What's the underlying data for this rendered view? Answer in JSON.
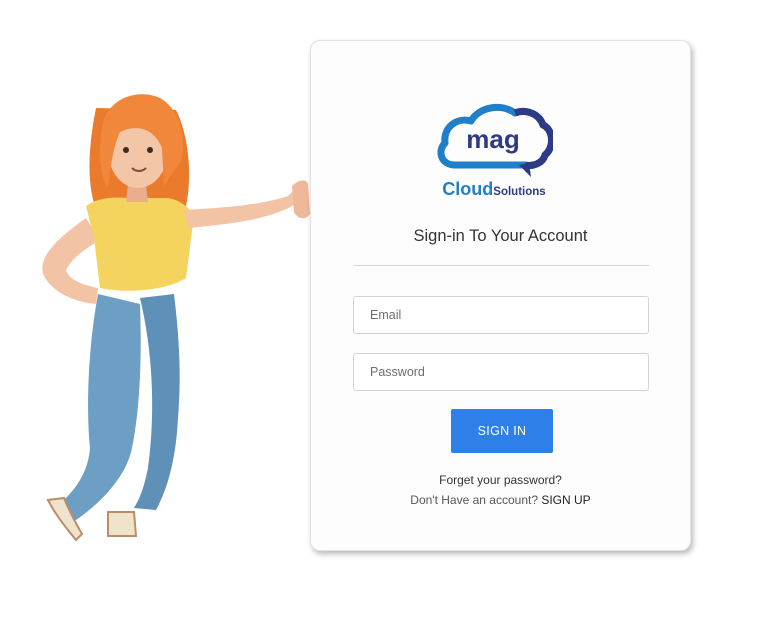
{
  "logo": {
    "mark_text": "mag",
    "word_cloud": "Cloud",
    "word_solutions": "Solutions"
  },
  "login": {
    "title": "Sign-in To Your Account",
    "email_placeholder": "Email",
    "password_placeholder": "Password",
    "signin_label": "SIGN IN",
    "forgot_label": "Forget your password?",
    "no_account_text": "Don't Have an account? ",
    "signup_label": "SIGN UP"
  },
  "colors": {
    "accent": "#2f7fe8",
    "logo_cyan": "#1f7fc8",
    "logo_navy": "#2f3a86"
  }
}
